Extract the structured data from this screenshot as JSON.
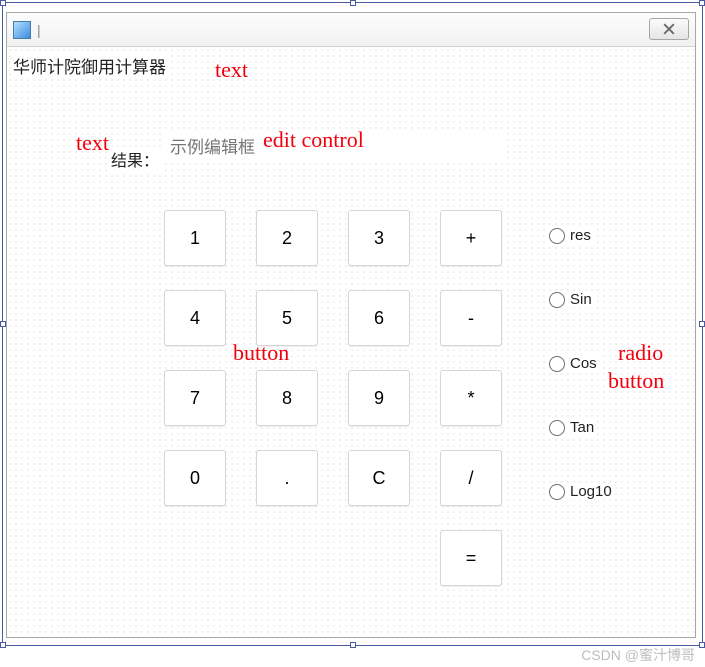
{
  "window": {
    "title_text": "华师计院御用计算器",
    "result_label": "结果：",
    "edit_placeholder": "示例编辑框"
  },
  "buttons": {
    "r0": [
      "1",
      "2",
      "3",
      "+"
    ],
    "r1": [
      "4",
      "5",
      "6",
      "-"
    ],
    "r2": [
      "7",
      "8",
      "9",
      "*"
    ],
    "r3": [
      "0",
      ".",
      "C",
      "/"
    ],
    "eq": "="
  },
  "radios": [
    "res",
    "Sin",
    "Cos",
    "Tan",
    "Log10"
  ],
  "annotations": {
    "text1": "text",
    "text2": "text",
    "edit": "edit control",
    "button": "button",
    "radio1": "radio",
    "radio2": "button"
  },
  "watermark": "CSDN @蜜汁博哥"
}
